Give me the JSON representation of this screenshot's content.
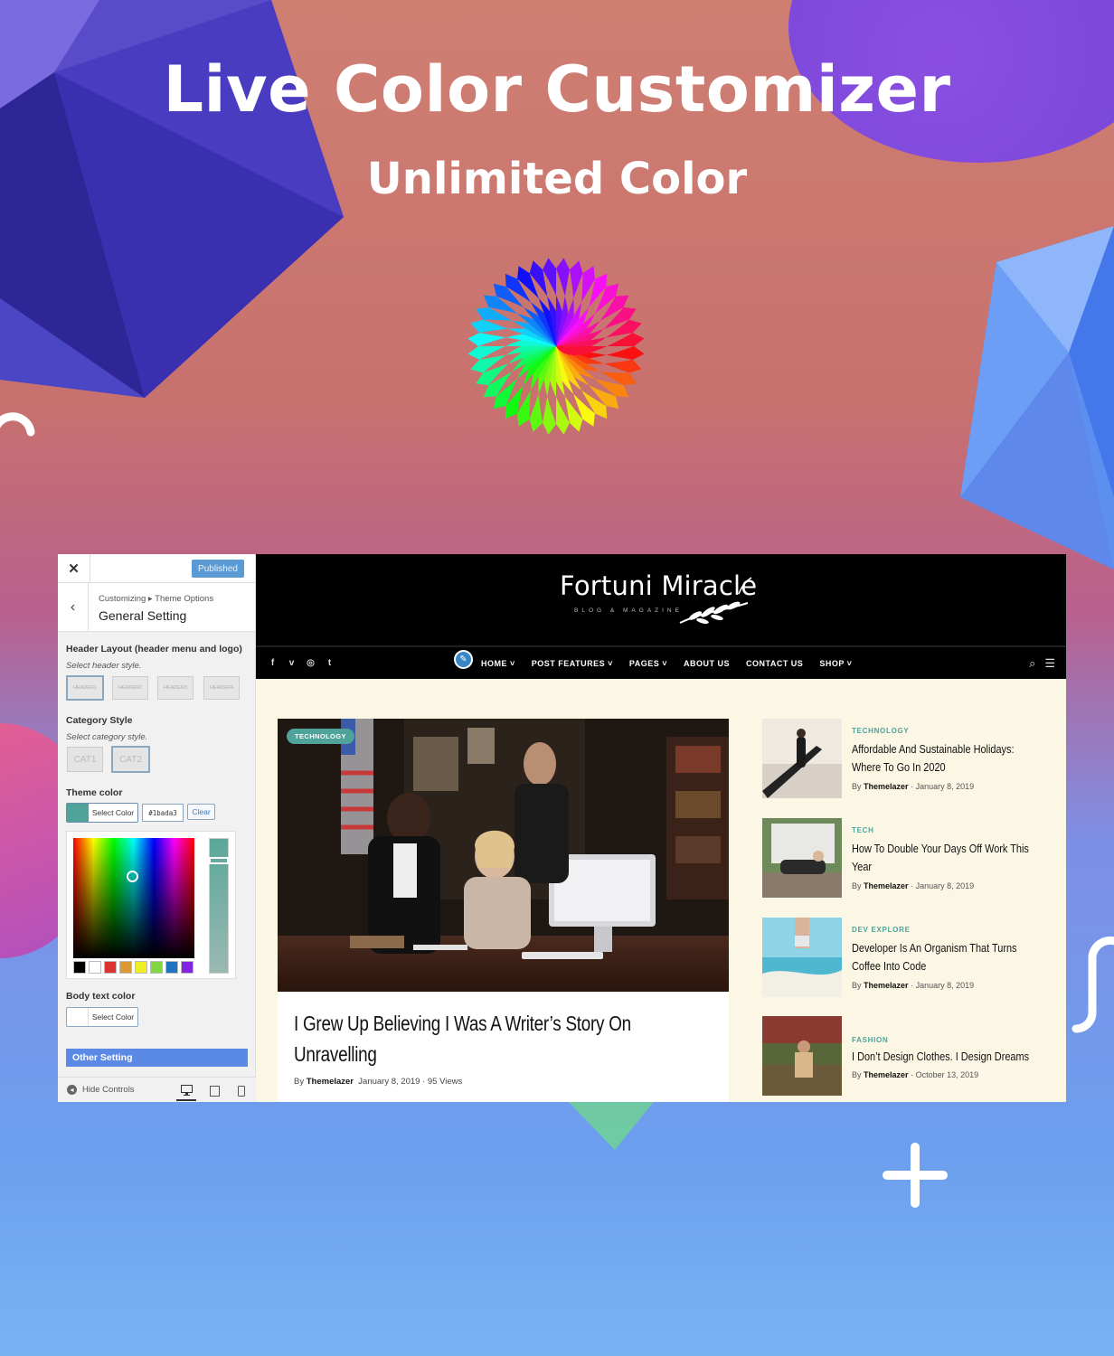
{
  "hero": {
    "title": "Live Color Customizer",
    "subtitle": "Unlimited Color"
  },
  "colors": {
    "theme": "#4fa39a",
    "accent_blue": "#5b8ae6",
    "published": "#5a9bd5",
    "site_bg": "#fbf7e4"
  },
  "customizer": {
    "close_icon": "close-icon",
    "published_label": "Published",
    "breadcrumb": "Customizing ▸ Theme Options",
    "title": "General Setting",
    "header_layout": {
      "label": "Header Layout (header menu and logo)",
      "hint": "Select header style.",
      "options": [
        "HEADER1",
        "HEADER2",
        "HEADER3",
        "HEADER4"
      ]
    },
    "category_style": {
      "label": "Category Style",
      "hint": "Select category style.",
      "options": [
        "CAT1",
        "CAT2"
      ]
    },
    "theme_color": {
      "label": "Theme color",
      "select_label": "Select Color",
      "hex_value": "#1bada3",
      "clear_label": "Clear",
      "palette": [
        "#000000",
        "#ffffff",
        "#dd3333",
        "#dd9933",
        "#eeee22",
        "#81d742",
        "#1e73be",
        "#8224e3"
      ]
    },
    "body_text_color": {
      "label": "Body text color",
      "select_label": "Select Color"
    },
    "other_setting": "Other Setting",
    "hide_controls": "Hide Controls"
  },
  "site": {
    "logo": "Fortuni Miracle",
    "tagline": "BLOG & MAGAZINE",
    "menu": [
      "HOME ˅",
      "POST FEATURES ˅",
      "PAGES ˅",
      "ABOUT US",
      "CONTACT US",
      "SHOP ˅"
    ],
    "featured": {
      "category": "TECHNOLOGY",
      "title_line1": "I Grew Up Believing I Was A Writer’s Story On",
      "title_line2": "Unravelling",
      "by": "By",
      "author": "Themelazer",
      "date": "January 8, 2019",
      "views": "95 Views"
    },
    "posts": [
      {
        "category": "TECHNOLOGY",
        "title_line1": "Affordable And Sustainable Holidays:",
        "title_line2": "Where To Go In 2020",
        "by": "By",
        "author": "Themelazer",
        "date": "January 8, 2019"
      },
      {
        "category": "TECH",
        "title_line1": "How To Double Your Days Off Work This",
        "title_line2": "Year",
        "by": "By",
        "author": "Themelazer",
        "date": "January 8, 2019"
      },
      {
        "category": "DEV EXPLORE",
        "title_line1": "Developer Is An Organism That Turns",
        "title_line2": "Coffee Into Code",
        "by": "By",
        "author": "Themelazer",
        "date": "January 8, 2019"
      },
      {
        "category": "FASHION",
        "title_line1": "I Don’t Design Clothes. I Design Dreams",
        "title_line2": "",
        "by": "By",
        "author": "Themelazer",
        "date": "October 13, 2019"
      }
    ]
  }
}
